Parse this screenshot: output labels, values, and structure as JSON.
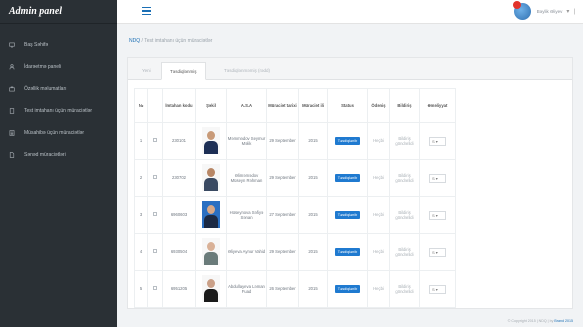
{
  "brand": "Admin panel",
  "sidebar": {
    "items": [
      {
        "label": "Baş Səhifə",
        "icon": "monitor-icon"
      },
      {
        "label": "İdarəetmə paneli",
        "icon": "user-icon"
      },
      {
        "label": "Özəllik məlumatları",
        "icon": "briefcase-icon"
      },
      {
        "label": "Test imtahanı üçün müraciətlər",
        "icon": "document-icon"
      },
      {
        "label": "Müsahibə üçün müraciətlər",
        "icon": "document-list-icon"
      },
      {
        "label": "Sənəd müraciətləri",
        "icon": "file-icon"
      }
    ]
  },
  "header": {
    "user_name": "Bəylik Əliyev",
    "menu_glyph": "≡",
    "avatar_color": "#3b82c4",
    "notification_color": "#e2332b"
  },
  "breadcrumb": {
    "home": "NDQ",
    "current": "Test imtahanı üçün müraciətlər"
  },
  "tabs": [
    {
      "label": "Yeni",
      "active": false
    },
    {
      "label": "Təsdiqlənmiş",
      "active": true
    },
    {
      "label": "Təsdiqlənməmiş (rədd)",
      "active": false
    }
  ],
  "table": {
    "headers": [
      "№",
      "",
      "İmtahan kodu",
      "Şəkil",
      "A.S.A",
      "Müraciət tarixi",
      "Müraciət ili",
      "Status",
      "Ödəniş",
      "Bildiriş",
      "Əməliyyat"
    ],
    "rows": [
      {
        "num": "1",
        "code": "230101",
        "name": "Məmmədov Seymur Məlik",
        "date": "29 September",
        "year": "2015",
        "status": "Təsdiqlənib",
        "payment": "Heçbi",
        "notice": "Bildiriş göndərildi",
        "action": "S"
      },
      {
        "num": "2",
        "code": "230702",
        "name": "Əliməmədov Müseyn Rəhman",
        "date": "29 September",
        "year": "2015",
        "status": "Təsdiqlənib",
        "payment": "Heçbi",
        "notice": "Bildiriş göndərildi",
        "action": "S"
      },
      {
        "num": "3",
        "code": "6960603",
        "name": "Hüseynova Səfiyə Sənan",
        "date": "27 September",
        "year": "2015",
        "status": "Təsdiqlənib",
        "payment": "Heçbi",
        "notice": "Bildiriş göndərildi",
        "action": "S"
      },
      {
        "num": "4",
        "code": "6930504",
        "name": "Əliyeva Aynur Vahid",
        "date": "29 September",
        "year": "2015",
        "status": "Təsdiqlənib",
        "payment": "Heçbi",
        "notice": "Bildiriş göndərildi",
        "action": "S"
      },
      {
        "num": "5",
        "code": "6951205",
        "name": "Abdullayeva Ləman Fuad",
        "date": "26 September",
        "year": "2015",
        "status": "Təsdiqlənib",
        "payment": "Heçbi",
        "notice": "Bildiriş göndərildi",
        "action": "S"
      }
    ]
  },
  "footer": {
    "text": "© Copyright 2015 | NDQ | by",
    "brand": "Brand 2015"
  },
  "colors": {
    "accent": "#1b6fb5",
    "status_button": "#1f7ad0",
    "sidebar": "#2a3035"
  }
}
